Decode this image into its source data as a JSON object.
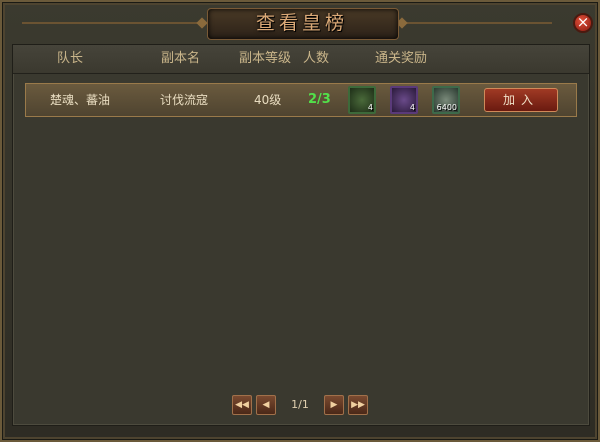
{
  "window": {
    "title": "查看皇榜",
    "close_label": "×"
  },
  "table": {
    "headers": {
      "captain": "队长",
      "dungeon": "副本名",
      "level": "副本等级",
      "players": "人数",
      "rewards": "通关奖励"
    },
    "rows": [
      {
        "captain": "楚魂、蕃油",
        "dungeon": "讨伐流寇",
        "level": "40级",
        "players": "2/3",
        "rewards": [
          {
            "icon": "horn-icon",
            "qty": "4"
          },
          {
            "icon": "purple-item-icon",
            "qty": "4"
          },
          {
            "icon": "silver-coin-icon",
            "qty": "6400"
          }
        ],
        "join_label": "加入"
      }
    ]
  },
  "pager": {
    "first": "◀◀",
    "prev": "◀",
    "page": "1/1",
    "next": "▶",
    "last": "▶▶"
  }
}
